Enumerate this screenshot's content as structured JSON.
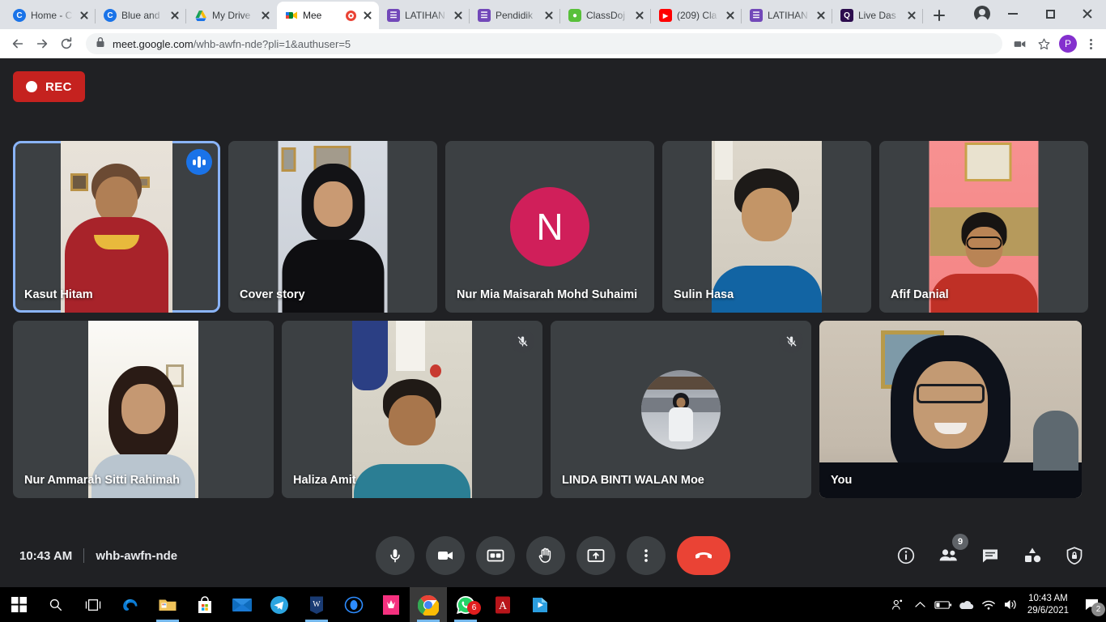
{
  "browser": {
    "tabs": [
      {
        "title": "Home - C",
        "favicon": "classroom-icon",
        "color": "#1a73e8",
        "glyph": "C",
        "active": false,
        "recording": false
      },
      {
        "title": "Blue and",
        "favicon": "classroom-icon",
        "color": "#1a73e8",
        "glyph": "C",
        "active": false,
        "recording": false
      },
      {
        "title": "My Drive",
        "favicon": "google-drive-icon",
        "color": "#ffffff",
        "glyph": "▲",
        "active": false,
        "recording": false
      },
      {
        "title": "Mee",
        "favicon": "google-meet-icon",
        "color": "#00832d",
        "glyph": "▶",
        "active": true,
        "recording": true
      },
      {
        "title": "LATIHAN",
        "favicon": "google-forms-icon",
        "color": "#7248b9",
        "glyph": "≡",
        "active": false,
        "recording": false
      },
      {
        "title": "Pendidik",
        "favicon": "google-forms-icon",
        "color": "#7248b9",
        "glyph": "≡",
        "active": false,
        "recording": false
      },
      {
        "title": "ClassDoj",
        "favicon": "classdojo-icon",
        "color": "#58c03a",
        "glyph": "●",
        "active": false,
        "recording": false
      },
      {
        "title": "(209) Cla",
        "favicon": "youtube-icon",
        "color": "#ff0000",
        "glyph": "▶",
        "active": false,
        "recording": false
      },
      {
        "title": "LATIHAN",
        "favicon": "google-forms-icon",
        "color": "#7248b9",
        "glyph": "≡",
        "active": false,
        "recording": false
      },
      {
        "title": "Live Das",
        "favicon": "quizizz-icon",
        "color": "#2d0d4e",
        "glyph": "Q",
        "active": false,
        "recording": false
      }
    ],
    "new_tab_label": "+",
    "url_host": "meet.google.com",
    "url_path": "/whb-awfn-nde?pli=1&authuser=5",
    "profile_letter": "P",
    "icons": {
      "back": "back-arrow-icon",
      "forward": "forward-arrow-icon",
      "reload": "reload-icon",
      "lock": "lock-icon",
      "media": "media-cast-icon",
      "bookmark": "star-icon",
      "menu": "kebab-menu-icon"
    }
  },
  "meet": {
    "recording_label": "REC",
    "time": "10:43 AM",
    "meeting_code": "whb-awfn-nde",
    "participants_count": "9",
    "participants": [
      {
        "name": "Kasut Hitam",
        "speaking": true,
        "muted": false,
        "kind": "video",
        "scene": "boy-red-shirt",
        "vw": 138
      },
      {
        "name": "Cover story",
        "speaking": false,
        "muted": false,
        "kind": "video",
        "scene": "girl-black-hijab",
        "vw": 135
      },
      {
        "name": "Nur Mia Maisarah Mohd Suhaimi",
        "speaking": false,
        "muted": false,
        "kind": "initial",
        "initial": "N",
        "initial_color": "#d01f5a",
        "vw": 0
      },
      {
        "name": "Sulin Hasa",
        "speaking": false,
        "muted": false,
        "kind": "video",
        "scene": "boy-blue-shirt",
        "vw": 136
      },
      {
        "name": "Afif Danial",
        "speaking": false,
        "muted": false,
        "kind": "video",
        "scene": "boy-glasses-pink",
        "vw": 135
      },
      {
        "name": "Nur Ammarah Sitti Rahimah",
        "speaking": false,
        "muted": false,
        "kind": "video",
        "scene": "girl-bright-room",
        "vw": 136
      },
      {
        "name": "Haliza Amit",
        "speaking": false,
        "muted": true,
        "kind": "video",
        "scene": "boy-teal-shirt",
        "vw": 148
      },
      {
        "name": "LINDA BINTI WALAN Moe",
        "speaking": false,
        "muted": true,
        "kind": "photo",
        "scene": "avatar-station",
        "vw": 0
      },
      {
        "name": "You",
        "speaking": false,
        "muted": false,
        "kind": "video",
        "scene": "woman-dark-hijab",
        "vw": 324
      }
    ],
    "controls": [
      {
        "name": "microphone-button",
        "icon": "microphone-icon"
      },
      {
        "name": "camera-button",
        "icon": "video-camera-icon"
      },
      {
        "name": "captions-button",
        "icon": "closed-captions-icon"
      },
      {
        "name": "raise-hand-button",
        "icon": "raised-hand-icon"
      },
      {
        "name": "present-now-button",
        "icon": "present-screen-icon"
      },
      {
        "name": "more-options-button",
        "icon": "kebab-menu-icon"
      },
      {
        "name": "leave-call-button",
        "icon": "hangup-phone-icon"
      }
    ],
    "right_controls": [
      {
        "name": "meeting-details-button",
        "icon": "info-icon"
      },
      {
        "name": "show-everyone-button",
        "icon": "people-icon",
        "badge": "9"
      },
      {
        "name": "chat-button",
        "icon": "chat-bubble-icon"
      },
      {
        "name": "activities-button",
        "icon": "shapes-icon"
      },
      {
        "name": "host-controls-button",
        "icon": "shield-lock-icon"
      }
    ]
  },
  "taskbar": {
    "items": [
      {
        "name": "start-button",
        "icon": "windows-logo-icon",
        "running": false,
        "active": false
      },
      {
        "name": "search-button",
        "icon": "search-icon",
        "running": false,
        "active": false
      },
      {
        "name": "task-view-button",
        "icon": "task-view-icon",
        "running": false,
        "active": false
      },
      {
        "name": "edge-button",
        "icon": "edge-icon",
        "running": false,
        "active": false
      },
      {
        "name": "file-explorer-button",
        "icon": "folder-icon",
        "running": true,
        "active": false
      },
      {
        "name": "microsoft-store-button",
        "icon": "store-icon",
        "running": false,
        "active": false
      },
      {
        "name": "mail-button",
        "icon": "mail-icon",
        "running": false,
        "active": false
      },
      {
        "name": "telegram-button",
        "icon": "telegram-icon",
        "running": false,
        "active": false
      },
      {
        "name": "wps-writer-button",
        "icon": "wps-writer-icon",
        "running": true,
        "active": false
      },
      {
        "name": "zoom-button",
        "icon": "zoom-icon",
        "running": false,
        "active": false
      },
      {
        "name": "canva-button",
        "icon": "canva-icon",
        "running": false,
        "active": false
      },
      {
        "name": "chrome-button",
        "icon": "chrome-icon",
        "running": true,
        "active": true
      },
      {
        "name": "whatsapp-button",
        "icon": "whatsapp-icon",
        "running": true,
        "active": false,
        "badge": "6"
      },
      {
        "name": "acrobat-button",
        "icon": "acrobat-reader-icon",
        "running": false,
        "active": false
      },
      {
        "name": "powerpoint-button",
        "icon": "powerpoint-icon",
        "running": false,
        "active": false
      }
    ],
    "tray": {
      "people_icon": "meet-now-people-icon",
      "chevron": "show-hidden-icons-icon",
      "battery": "battery-icon",
      "onedrive": "onedrive-icon",
      "wifi": "wifi-icon",
      "volume": "volume-icon",
      "time": "10:43 AM",
      "date": "29/6/2021",
      "notification_count": "2"
    }
  }
}
